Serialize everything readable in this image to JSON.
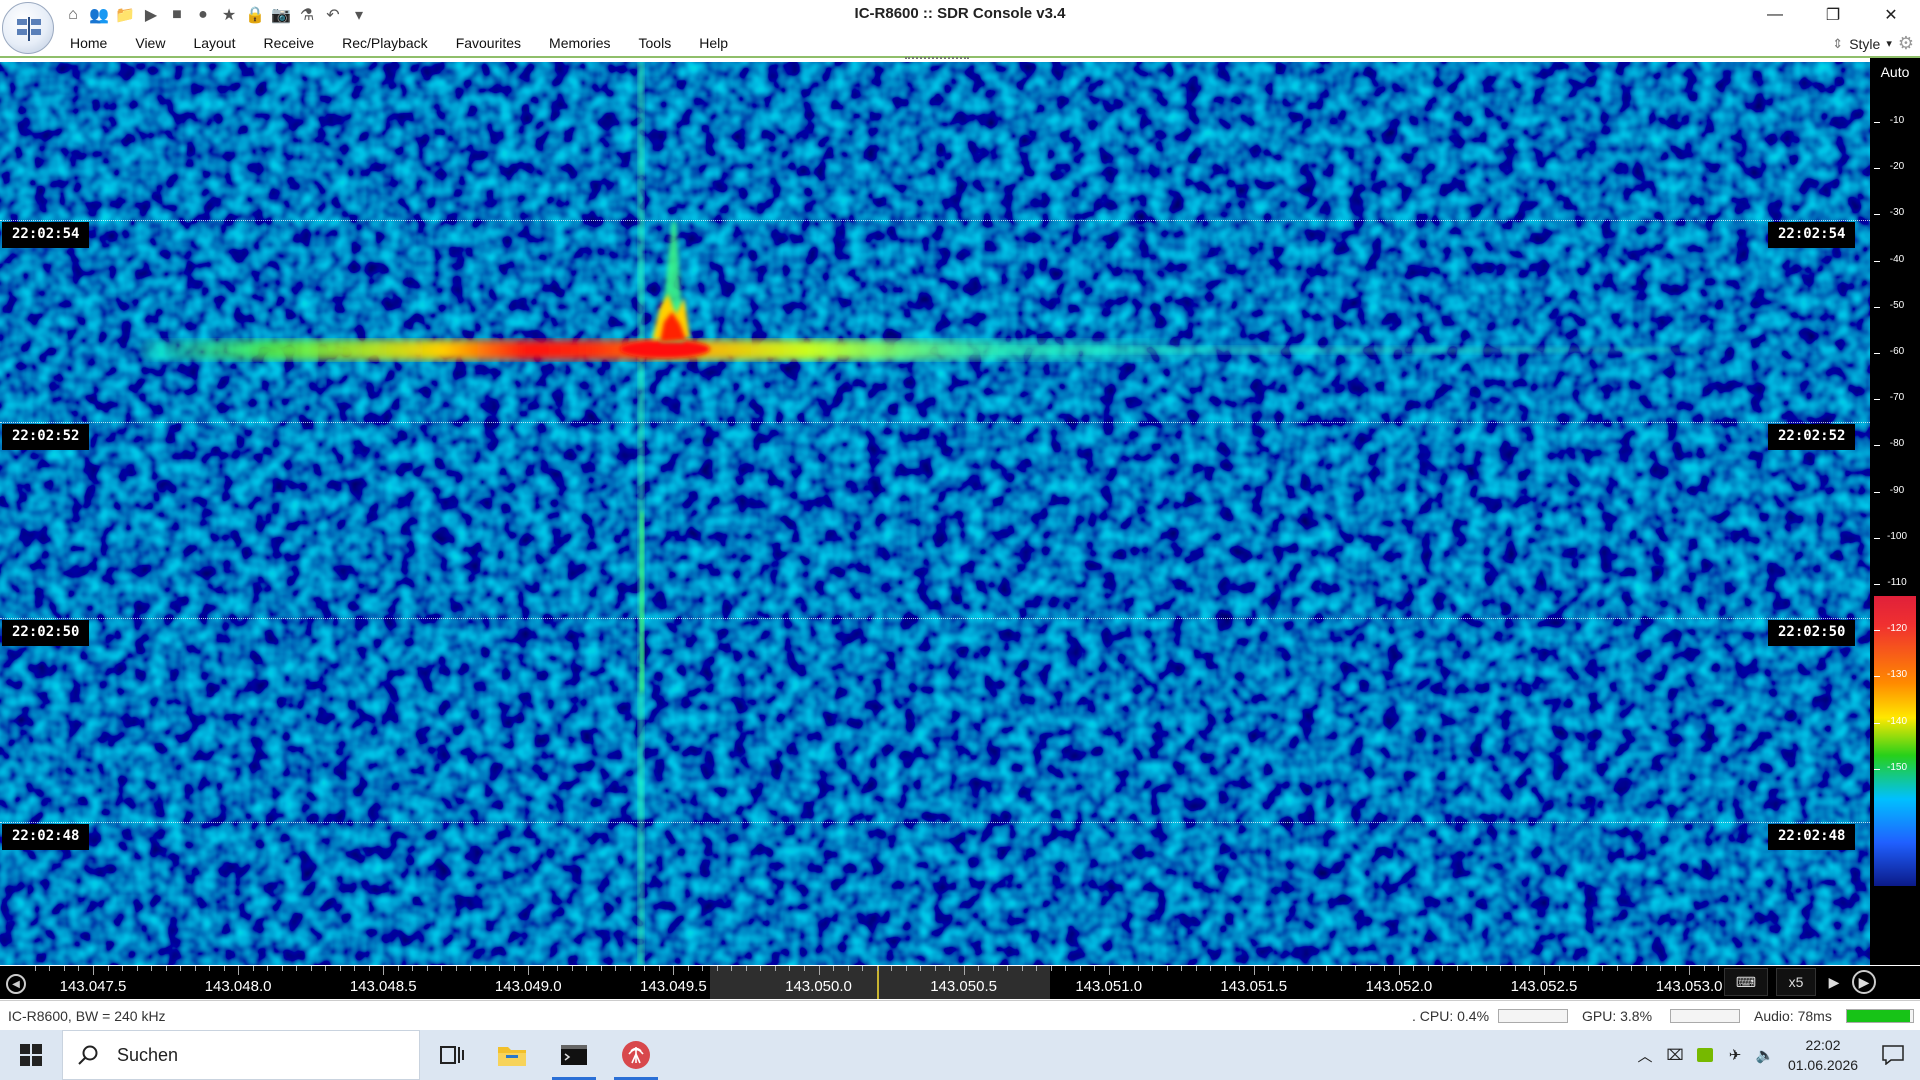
{
  "window": {
    "title": "IC-R8600 :: SDR Console v3.4",
    "minimize_glyph": "—",
    "maximize_glyph": "❐",
    "close_glyph": "✕"
  },
  "quick_access": [
    {
      "name": "home-icon",
      "glyph": "⌂"
    },
    {
      "name": "users-icon",
      "glyph": "👥"
    },
    {
      "name": "folder-icon",
      "glyph": "📁"
    },
    {
      "name": "play-icon",
      "glyph": "▶"
    },
    {
      "name": "stop-icon",
      "glyph": "■"
    },
    {
      "name": "record-icon",
      "glyph": "●"
    },
    {
      "name": "star-icon",
      "glyph": "★"
    },
    {
      "name": "lock-icon",
      "glyph": "🔒"
    },
    {
      "name": "camera-icon",
      "glyph": "📷"
    },
    {
      "name": "flask-icon",
      "glyph": "⚗"
    },
    {
      "name": "undo-icon",
      "glyph": "↶"
    },
    {
      "name": "customize-dropdown-icon",
      "glyph": "▾"
    }
  ],
  "menu": {
    "items": [
      "Home",
      "View",
      "Layout",
      "Receive",
      "Rec/Playback",
      "Favourites",
      "Memories",
      "Tools",
      "Help"
    ],
    "style_label": "Style"
  },
  "waterfall": {
    "time_labels": [
      "22:02:54",
      "22:02:52",
      "22:02:50",
      "22:02:48"
    ]
  },
  "scale": {
    "mode": "Auto",
    "ticks": [
      "-10",
      "-20",
      "-30",
      "-40",
      "-50",
      "-60",
      "-70",
      "-80",
      "-90",
      "-100",
      "-110",
      "-120",
      "-130",
      "-140",
      "-150"
    ]
  },
  "frequency": {
    "labels": [
      "143.047.5",
      "143.048.0",
      "143.048.5",
      "143.049.0",
      "143.049.5",
      "143.050.0",
      "143.050.5",
      "143.051.0",
      "143.051.5",
      "143.052.0",
      "143.052.5",
      "143.053.0"
    ],
    "zoom": "x5"
  },
  "status": {
    "device": "IC-R8600, BW = 240 kHz",
    "cpu": ". CPU: 0.4%",
    "gpu": "GPU: 3.8%",
    "audio": "Audio: 78ms",
    "audio_level": 0.95
  },
  "taskbar": {
    "search_placeholder": "Suchen",
    "time": "22:02",
    "date": "01.06.2026"
  },
  "colors": {
    "accent_green": "#17c317",
    "taskbar_bg": "#dce6f2",
    "center_line": "#c8b430"
  }
}
